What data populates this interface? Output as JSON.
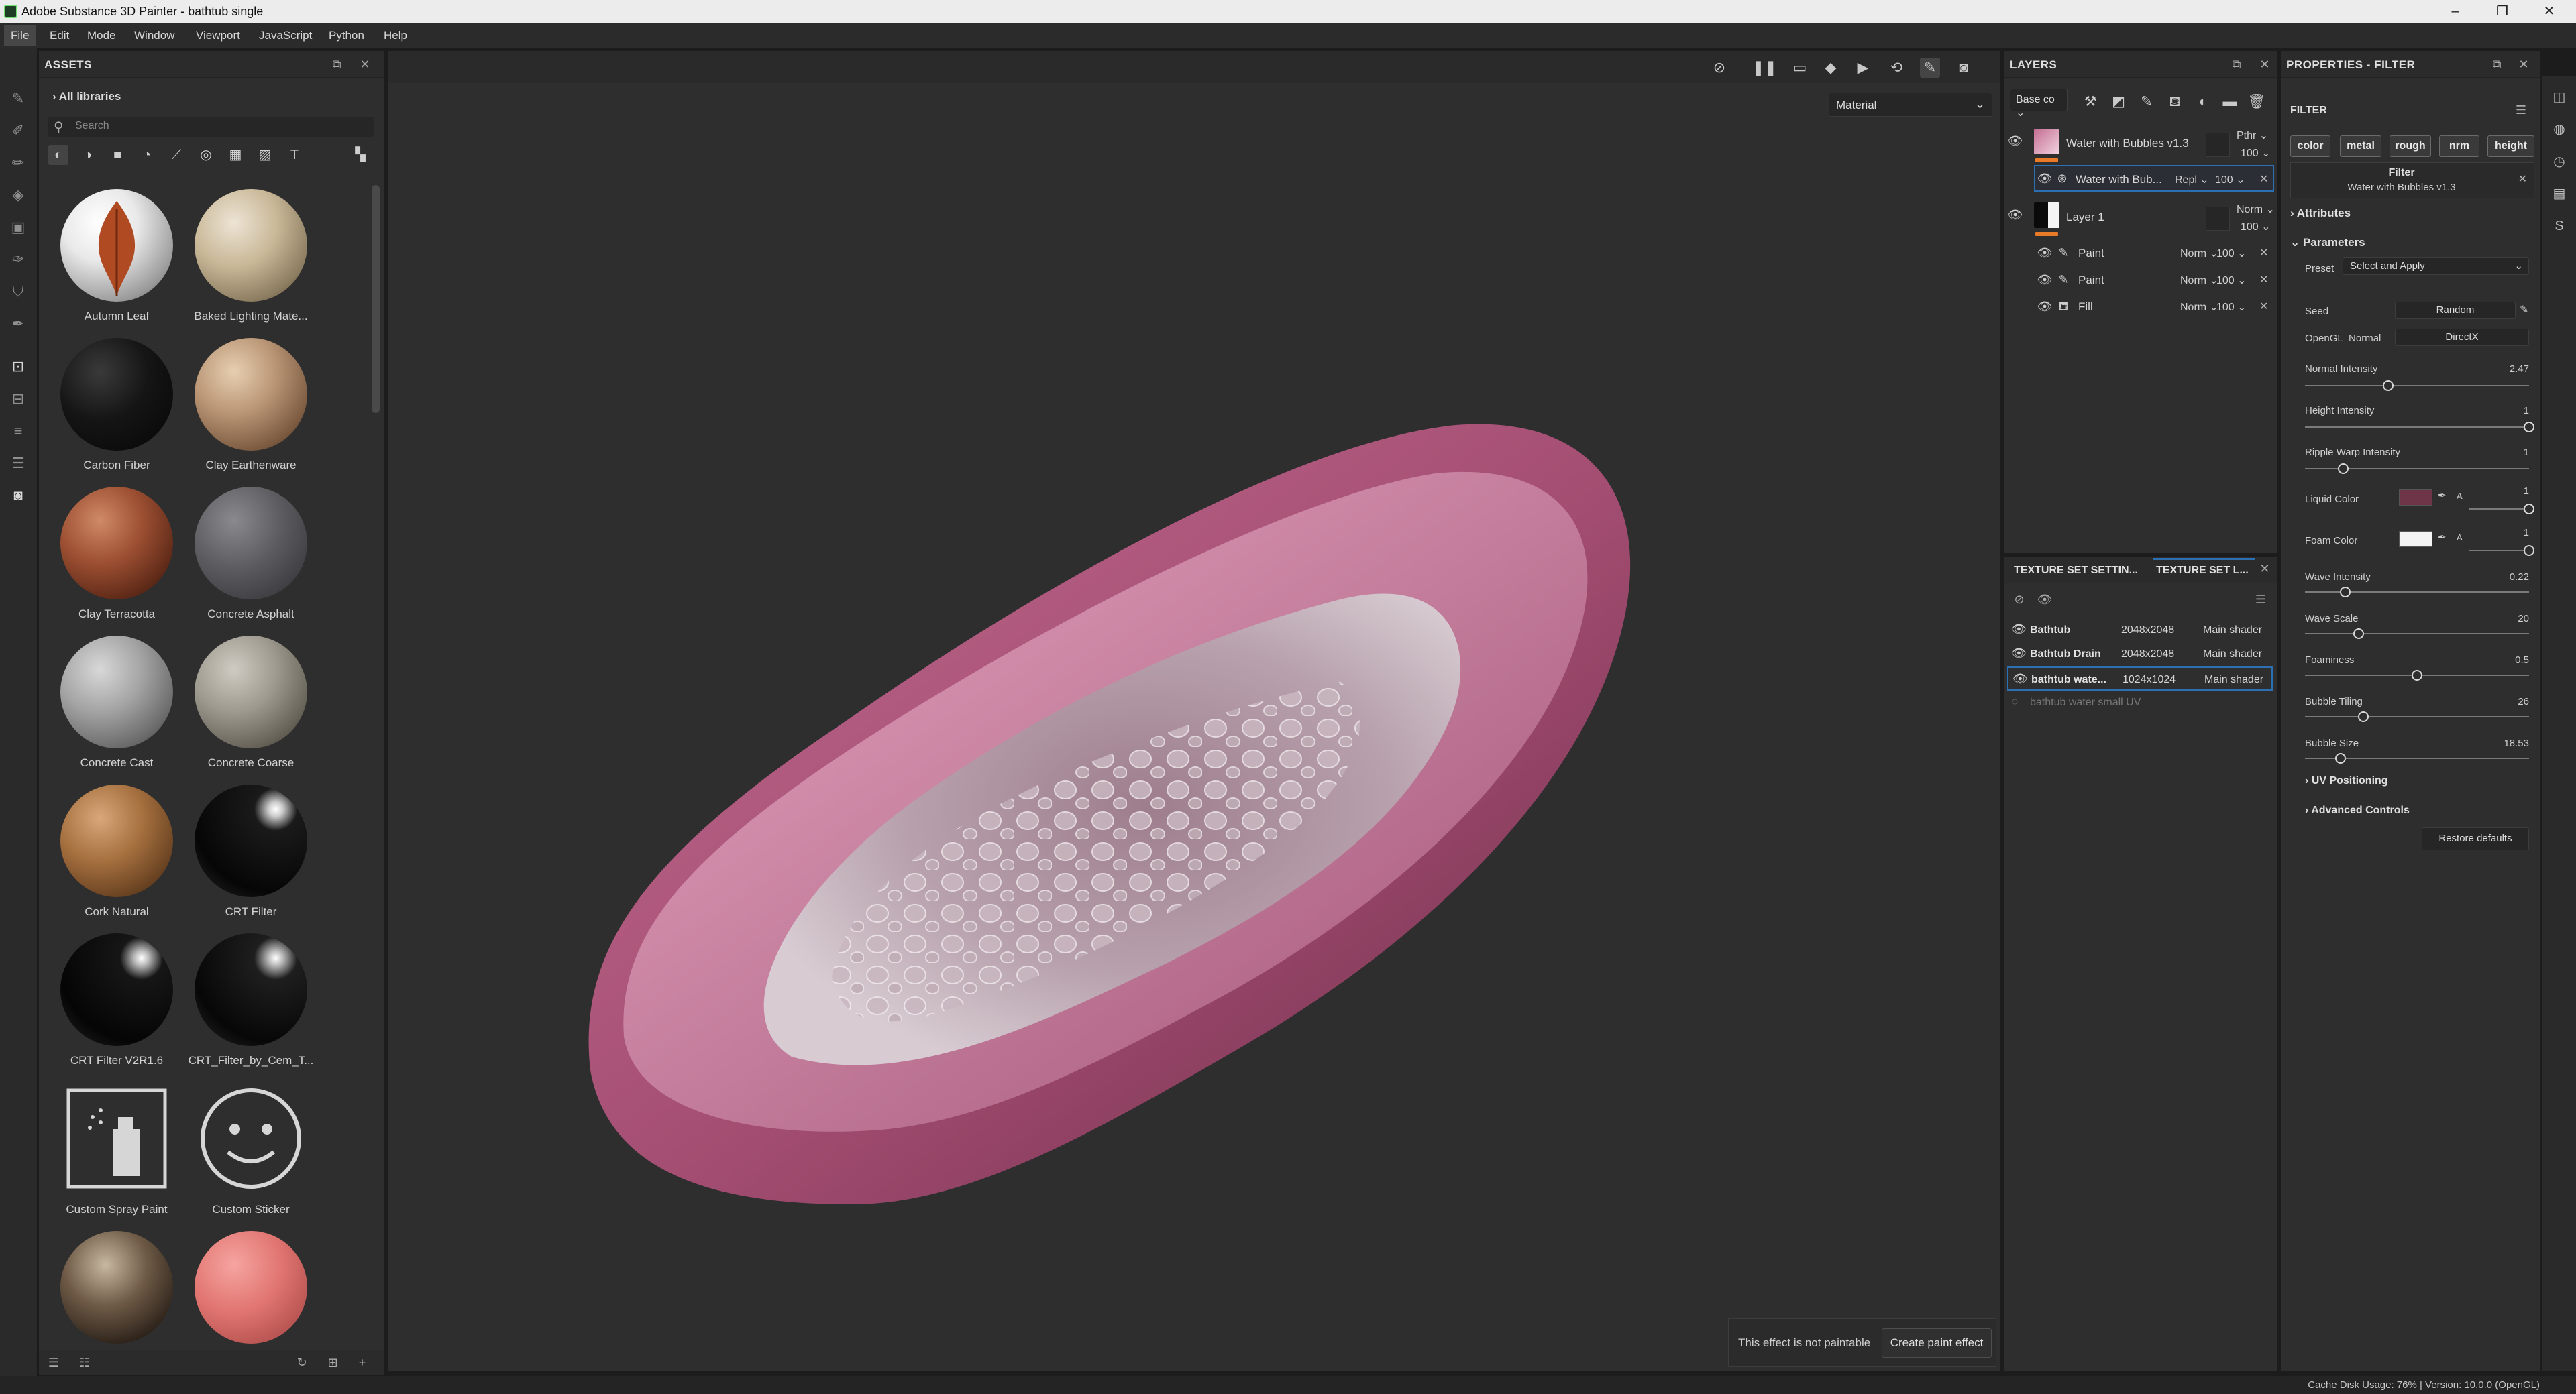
{
  "window": {
    "title": "Adobe Substance 3D Painter - bathtub single",
    "controls": [
      "–",
      "❐",
      "✕"
    ]
  },
  "menu": [
    "File",
    "Edit",
    "Mode",
    "Window",
    "Viewport",
    "JavaScript",
    "Python",
    "Help"
  ],
  "assets": {
    "title": "ASSETS",
    "library": "All libraries",
    "search_placeholder": "Search",
    "items": [
      {
        "label": "Autumn Leaf"
      },
      {
        "label": "Baked Lighting Mate..."
      },
      {
        "label": "Carbon Fiber"
      },
      {
        "label": "Clay Earthenware"
      },
      {
        "label": "Clay Terracotta"
      },
      {
        "label": "Concrete Asphalt"
      },
      {
        "label": "Concrete Cast"
      },
      {
        "label": "Concrete Coarse"
      },
      {
        "label": "Cork Natural"
      },
      {
        "label": "CRT Filter"
      },
      {
        "label": "CRT Filter V2R1.6"
      },
      {
        "label": "CRT_Filter_by_Cem_T..."
      },
      {
        "label": "Custom Spray Paint"
      },
      {
        "label": "Custom Sticker"
      },
      {
        "label": ""
      },
      {
        "label": ""
      }
    ]
  },
  "viewport": {
    "channel": "Material",
    "note": "This effect is not paintable",
    "create_button": "Create paint effect"
  },
  "layers": {
    "title": "LAYERS",
    "channel_combo": "Base co",
    "rows": [
      {
        "name": "Water with Bubbles v1.3",
        "blend": "Pthr",
        "opacity": "100"
      },
      {
        "name": "Water with Bub...",
        "blend": "Repl",
        "opacity": "100"
      },
      {
        "name": "Layer 1",
        "blend": "Norm",
        "opacity": "100"
      },
      {
        "name": "Paint",
        "blend": "Norm",
        "opacity": "100"
      },
      {
        "name": "Paint",
        "blend": "Norm",
        "opacity": "100"
      },
      {
        "name": "Fill",
        "blend": "Norm",
        "opacity": "100"
      }
    ]
  },
  "texture_sets": {
    "tab1": "TEXTURE SET SETTIN...",
    "tab2": "TEXTURE SET L...",
    "rows": [
      {
        "name": "Bathtub",
        "res": "2048x2048",
        "shader": "Main shader"
      },
      {
        "name": "Bathtub Drain",
        "res": "2048x2048",
        "shader": "Main shader"
      },
      {
        "name": "bathtub wate...",
        "res": "1024x1024",
        "shader": "Main shader"
      },
      {
        "name": "bathtub water small UV",
        "res": "",
        "shader": ""
      }
    ]
  },
  "properties": {
    "title": "PROPERTIES - FILTER",
    "section": "FILTER",
    "channels": [
      "color",
      "metal",
      "rough",
      "nrm",
      "height"
    ],
    "filter_label": "Filter",
    "filter_name": "Water with Bubbles v1.3",
    "attributes": "Attributes",
    "parameters": "Parameters",
    "preset_label": "Preset",
    "preset_value": "Select and Apply",
    "seed_label": "Seed",
    "seed_value": "Random",
    "opengl_label": "OpenGL_Normal",
    "opengl_value": "DirectX",
    "sliders": [
      {
        "label": "Normal Intensity",
        "value": "2.47",
        "pos": 0.37
      },
      {
        "label": "Height Intensity",
        "value": "1",
        "pos": 1.0
      },
      {
        "label": "Ripple Warp Intensity",
        "value": "1",
        "pos": 0.17
      }
    ],
    "liquid_color": {
      "label": "Liquid Color",
      "value": "1",
      "swatch": "#6e3548"
    },
    "foam_color": {
      "label": "Foam Color",
      "value": "1",
      "swatch": "#f4f4f4"
    },
    "sliders2": [
      {
        "label": "Wave Intensity",
        "value": "0.22",
        "pos": 0.18
      },
      {
        "label": "Wave Scale",
        "value": "20",
        "pos": 0.24
      },
      {
        "label": "Foaminess",
        "value": "0.5",
        "pos": 0.5
      },
      {
        "label": "Bubble Tiling",
        "value": "26",
        "pos": 0.26
      },
      {
        "label": "Bubble Size",
        "value": "18.53",
        "pos": 0.16
      }
    ],
    "uv_positioning": "UV Positioning",
    "advanced": "Advanced Controls",
    "restore": "Restore defaults"
  },
  "status": {
    "text": "Cache Disk Usage:    76% | Version: 10.0.0 (OpenGL)"
  }
}
